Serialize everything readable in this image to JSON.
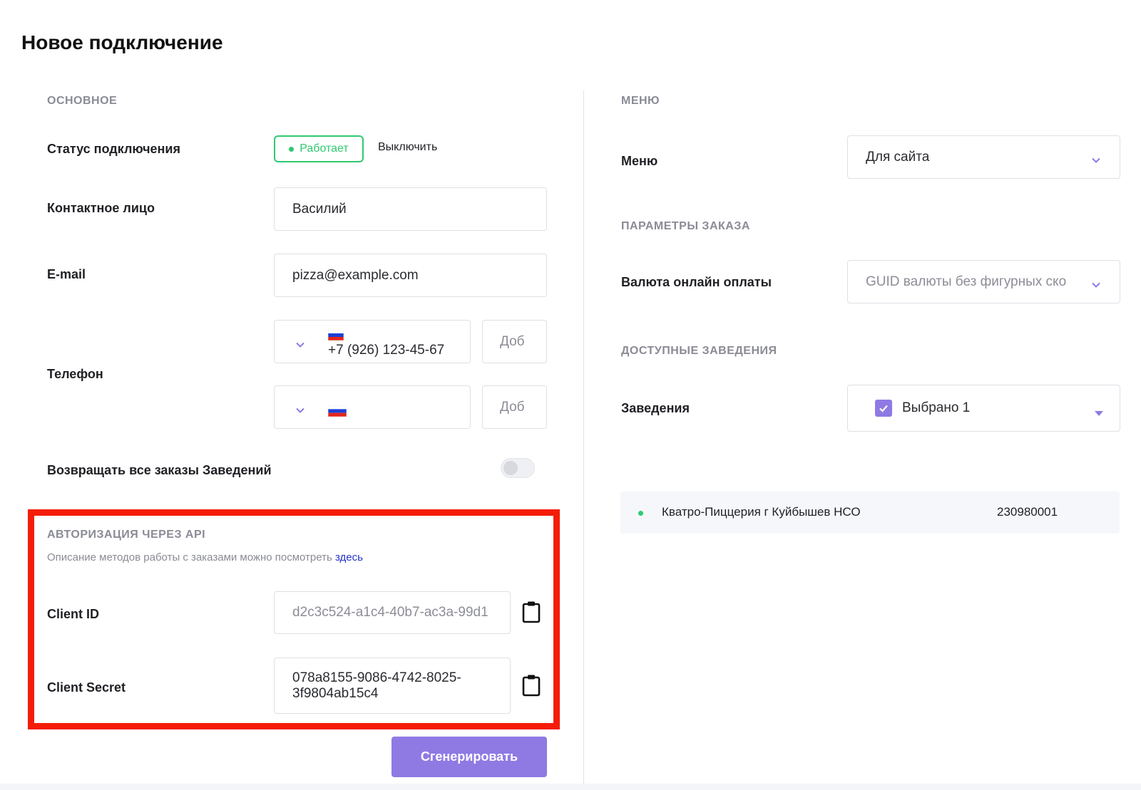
{
  "page": {
    "title": "Новое подключение"
  },
  "main": {
    "section_title": "ОСНОВНОЕ",
    "status": {
      "label": "Статус подключения",
      "badge": "Работает",
      "disable_label": "Выключить"
    },
    "contact": {
      "label": "Контактное лицо",
      "value": "Василий"
    },
    "email": {
      "label": "E-mail",
      "value": "pizza@example.com"
    },
    "phone": {
      "label": "Телефон",
      "first": {
        "value": "+7 (926) 123-45-67",
        "ext_placeholder": "Доб"
      },
      "second": {
        "value": "",
        "ext_placeholder": "Доб"
      }
    },
    "return_orders": {
      "label": "Возвращать все заказы Заведений",
      "enabled": false
    }
  },
  "api": {
    "section_title": "АВТОРИЗАЦИЯ ЧЕРЕЗ API",
    "description": "Описание методов работы с заказами можно посмотреть",
    "link_text": "здесь",
    "client_id": {
      "label": "Client ID",
      "value": "d2c3c524-a1c4-40b7-ac3a-99d1"
    },
    "client_secret": {
      "label": "Client Secret",
      "value_line1": "078a8155-9086-4742-8025-",
      "value_line2": "3f9804ab15c4"
    },
    "generate_label": "Сгенерировать"
  },
  "menu": {
    "section_title": "МЕНЮ",
    "label": "Меню",
    "value": "Для сайта"
  },
  "order_params": {
    "section_title": "ПАРАМЕТРЫ ЗАКАЗА",
    "currency_label": "Валюта онлайн оплаты",
    "currency_placeholder": "GUID валюты без фигурных ско"
  },
  "venues": {
    "section_title": "ДОСТУПНЫЕ ЗАВЕДЕНИЯ",
    "label": "Заведения",
    "selected_text": "Выбрано 1",
    "items": [
      {
        "name": "Кватро-Пиццерия г Куйбышев НСО",
        "code": "230980001"
      }
    ]
  },
  "colors": {
    "accent": "#8f7ae4",
    "success": "#2ec971",
    "highlight_border": "#f41c08",
    "link": "#2233cc"
  }
}
